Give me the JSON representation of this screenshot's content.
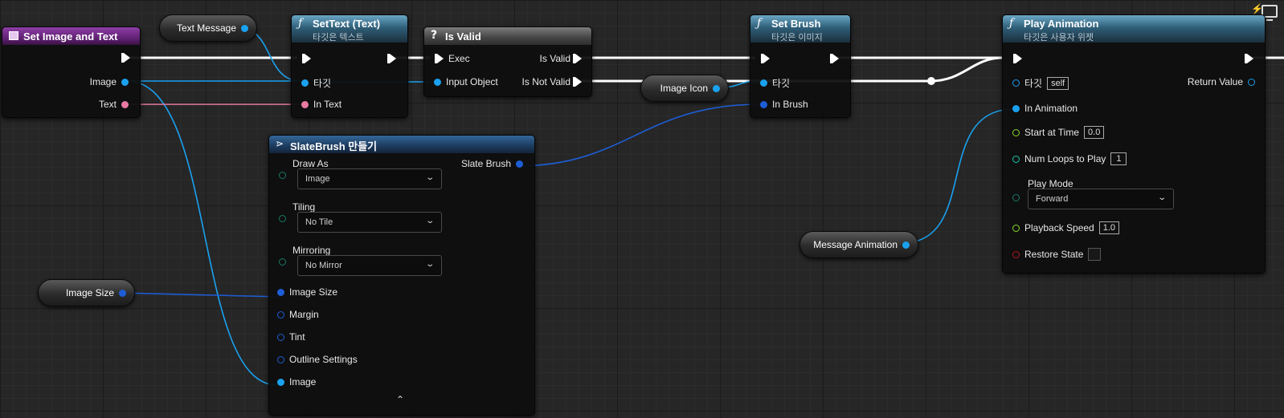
{
  "nodes": {
    "entry": {
      "title": "Set Image and Text",
      "pins": {
        "image": "Image",
        "text": "Text"
      }
    },
    "set_text": {
      "title": "SetText (Text)",
      "subtitle": "타깃은 텍스트",
      "pins": {
        "target": "타깃",
        "in_text": "In Text"
      }
    },
    "is_valid": {
      "icon": "?",
      "title": "Is Valid",
      "pins": {
        "exec": "Exec",
        "input": "Input Object",
        "is_valid": "Is Valid",
        "is_not_valid": "Is Not Valid"
      }
    },
    "set_brush": {
      "title": "Set Brush",
      "subtitle": "타깃은 이미지",
      "pins": {
        "target": "타깃",
        "in_brush": "In Brush"
      }
    },
    "play_anim": {
      "title": "Play Animation",
      "subtitle": "타깃은 사용자 위젯",
      "pins": {
        "target": "타깃",
        "target_value": "self",
        "return_value": "Return Value",
        "in_animation": "In Animation",
        "start_time": "Start at Time",
        "start_time_value": "0.0",
        "num_loops": "Num Loops to Play",
        "num_loops_value": "1",
        "play_mode": "Play Mode",
        "play_mode_value": "Forward",
        "playback_speed": "Playback Speed",
        "playback_speed_value": "1.0",
        "restore_state": "Restore State"
      }
    },
    "make_brush": {
      "title": "SlateBrush 만들기",
      "draw_as": {
        "label": "Draw As",
        "value": "Image"
      },
      "tiling": {
        "label": "Tiling",
        "value": "No Tile"
      },
      "mirroring": {
        "label": "Mirroring",
        "value": "No Mirror"
      },
      "pins": {
        "slate_brush": "Slate Brush",
        "image_size": "Image Size",
        "margin": "Margin",
        "tint": "Tint",
        "outline": "Outline Settings",
        "image": "Image"
      }
    }
  },
  "variables": {
    "text_message": "Text Message",
    "image_icon": "Image Icon",
    "message_animation": "Message Animation",
    "image_size": "Image Size"
  },
  "icons": {
    "function": "ƒ",
    "chevron_down": "⌄",
    "chevron_up": "⌃"
  },
  "colors": {
    "exec_wire": "#ffffff",
    "object_wire": "#1aa1ef",
    "text_wire": "#e67aa3",
    "struct_wire": "#1d5ed6",
    "entry_header": "#6b2a80",
    "function_header": "#2f5f79"
  }
}
